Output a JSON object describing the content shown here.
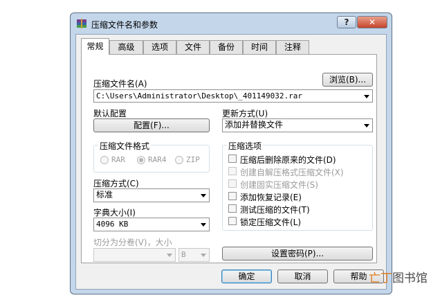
{
  "window": {
    "title": "压缩文件名和参数",
    "help_glyph": "?",
    "close_glyph": "✕"
  },
  "tabs": [
    {
      "label": "常规",
      "active": true
    },
    {
      "label": "高级"
    },
    {
      "label": "选项"
    },
    {
      "label": "文件"
    },
    {
      "label": "备份"
    },
    {
      "label": "时间"
    },
    {
      "label": "注释"
    }
  ],
  "archive": {
    "name_label": "压缩文件名(A)",
    "browse_label": "浏览(B)...",
    "name_value": "C:\\Users\\Administrator\\Desktop\\_401149032.rar"
  },
  "profile": {
    "label": "默认配置",
    "button": "配置(F)..."
  },
  "update": {
    "label": "更新方式(U)",
    "value": "添加并替换文件"
  },
  "format": {
    "group_label": "压缩文件格式",
    "options": [
      "RAR",
      "RAR4",
      "ZIP"
    ],
    "selected": "RAR4"
  },
  "options": {
    "group_label": "压缩选项",
    "items": [
      {
        "label": "压缩后删除原来的文件(D)",
        "enabled": true,
        "checked": false
      },
      {
        "label": "创建自解压格式压缩文件(X)",
        "enabled": false,
        "checked": false
      },
      {
        "label": "创建固实压缩文件(S)",
        "enabled": false,
        "checked": false
      },
      {
        "label": "添加恢复记录(E)",
        "enabled": true,
        "checked": false
      },
      {
        "label": "测试压缩的文件(T)",
        "enabled": true,
        "checked": false
      },
      {
        "label": "锁定压缩文件(L)",
        "enabled": true,
        "checked": false
      }
    ]
  },
  "method": {
    "label": "压缩方式(C)",
    "value": "标准"
  },
  "dict": {
    "label": "字典大小(I)",
    "value": "4096 KB"
  },
  "split": {
    "label": "切分为分卷(V)，大小",
    "value": "",
    "unit": "B"
  },
  "password": {
    "button": "设置密码(P)..."
  },
  "footer": {
    "ok": "确定",
    "cancel": "取消",
    "help": "帮助"
  },
  "watermark": {
    "prefix": "亡丁",
    "suffix": "图书馆"
  }
}
